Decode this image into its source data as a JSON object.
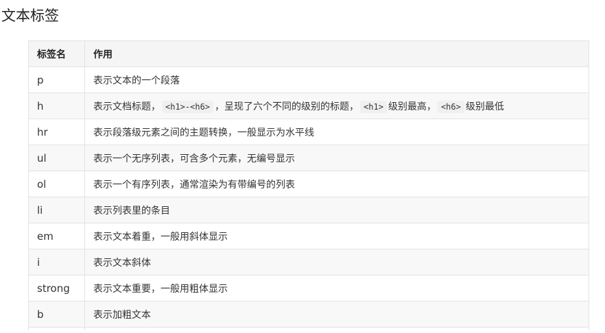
{
  "page": {
    "title": "文本标签"
  },
  "table": {
    "headers": [
      "标签名",
      "作用"
    ],
    "rows": [
      {
        "tag": "p",
        "desc": "表示文本的一个段落"
      },
      {
        "tag": "h",
        "desc_parts": [
          "表示文档标题，",
          "<h1>-<h6>",
          "，呈现了六个不同的级别的标题，",
          "<h1>",
          "级别最高，",
          "<h6>",
          "级别最低"
        ]
      },
      {
        "tag": "hr",
        "desc": "表示段落级元素之间的主题转换，一般显示为水平线"
      },
      {
        "tag": "ul",
        "desc": "表示一个无序列表，可含多个元素，无编号显示"
      },
      {
        "tag": "ol",
        "desc": "表示一个有序列表，通常渲染为有带编号的列表"
      },
      {
        "tag": "li",
        "desc": "表示列表里的条目"
      },
      {
        "tag": "em",
        "desc": "表示文本着重，一般用斜体显示"
      },
      {
        "tag": "i",
        "desc": "表示文本斜体"
      },
      {
        "tag": "strong",
        "desc": "表示文本重要，一般用粗体显示"
      },
      {
        "tag": "b",
        "desc": "表示加粗文本"
      }
    ]
  }
}
